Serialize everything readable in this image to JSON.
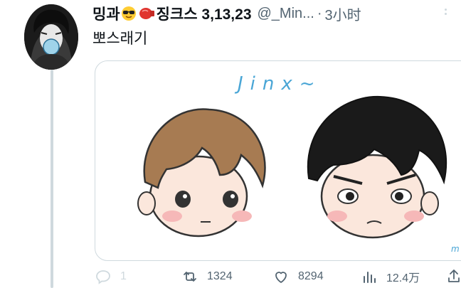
{
  "tweet": {
    "display_name": "밍과",
    "display_name_suffix": "징크스 3,13,23",
    "handle": "@_Min...",
    "separator": "·",
    "time": "3小时",
    "text": "뽀스래기"
  },
  "media": {
    "handwritten_title": "Jinx~"
  },
  "actions": {
    "reply_count": "1",
    "retweet_count": "1324",
    "like_count": "8294",
    "view_count": "12.4万"
  },
  "colors": {
    "secondary_text": "#536471",
    "border": "#cfd9de"
  }
}
